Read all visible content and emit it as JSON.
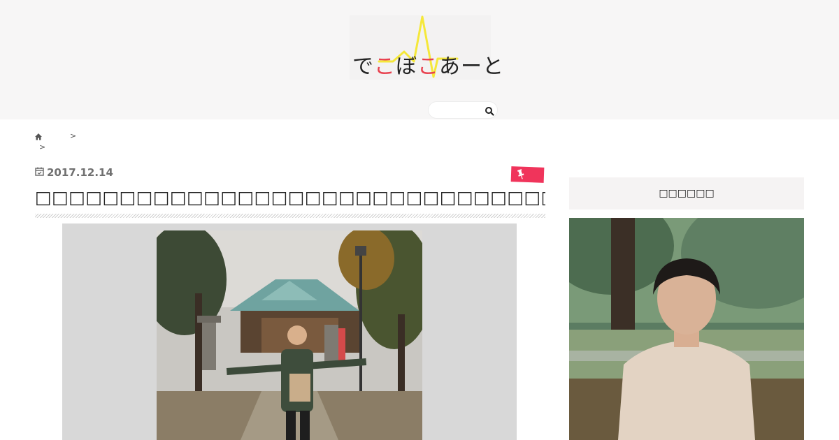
{
  "header": {
    "logo_text_1": "で",
    "logo_text_2": "こ",
    "logo_text_3": "ぼ",
    "logo_text_4": "こ",
    "logo_text_5": "あーと",
    "logo_colors": {
      "text": "#222222",
      "accent": "#e8414f",
      "pulse": "#f5e83a"
    },
    "search": {
      "placeholder": "",
      "icon": "search-icon"
    }
  },
  "breadcrumb": {
    "home_icon": "home-icon",
    "separator_1": ">",
    "separator_2": ">"
  },
  "article": {
    "date": "2017.12.14",
    "date_icon": "calendar-check-icon",
    "category_icon": "pushpin-icon",
    "category_color": "#f0345b",
    "title": "□□□□□□□□□□□□□□□□□□□□□□□□□□□□□□□□□□□",
    "title_rule_style": "diagonal-hatch"
  },
  "sidebar": {
    "heading": "□□□□□□",
    "profile_photo": "profile-photo"
  },
  "colors": {
    "header_bg": "#f7f6f6",
    "sidebar_head_bg": "#f5f3f3",
    "badge": "#f0345b"
  }
}
